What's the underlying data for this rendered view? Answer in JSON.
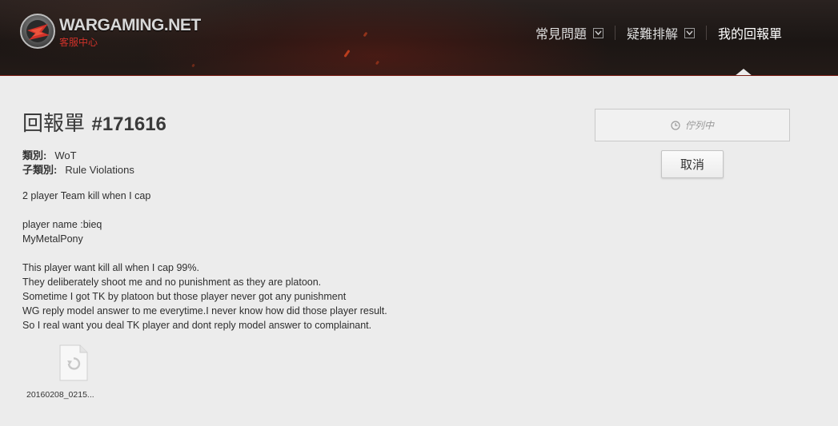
{
  "header": {
    "logo_text": "WARGAMING.NET",
    "logo_subtitle": "客服中心",
    "nav": [
      {
        "label": "常見問題",
        "has_dropdown": true
      },
      {
        "label": "疑難排解",
        "has_dropdown": true
      },
      {
        "label": "我的回報單",
        "has_dropdown": false,
        "active": true
      }
    ]
  },
  "ticket": {
    "title_label": "回報單",
    "number": "#171616",
    "category_label": "類別:",
    "category_value": "WoT",
    "subcategory_label": "子類別:",
    "subcategory_value": "Rule Violations",
    "body": [
      "2 player Team kill when I cap",
      "",
      "player name :bieq",
      "MyMetalPony",
      "",
      "This player want kill all when I cap 99%.",
      "They deliberately shoot me and no punishment as they are platoon.",
      "Sometime I got TK by platoon but those player never got any punishment",
      "WG reply model answer to me everytime.I never know how did those player result.",
      "So I real want you deal TK player and dont reply model answer to complainant."
    ],
    "attachment": {
      "file_name": "20160208_0215...",
      "icon": "file-refresh-icon"
    }
  },
  "status_panel": {
    "status_text": "佇列中",
    "status_icon": "clock-icon",
    "cancel_label": "取消"
  },
  "colors": {
    "header_bg": "#1b1614",
    "header_border": "#7a1d14",
    "brand_red": "#d0322a",
    "page_bg": "#ececec"
  }
}
